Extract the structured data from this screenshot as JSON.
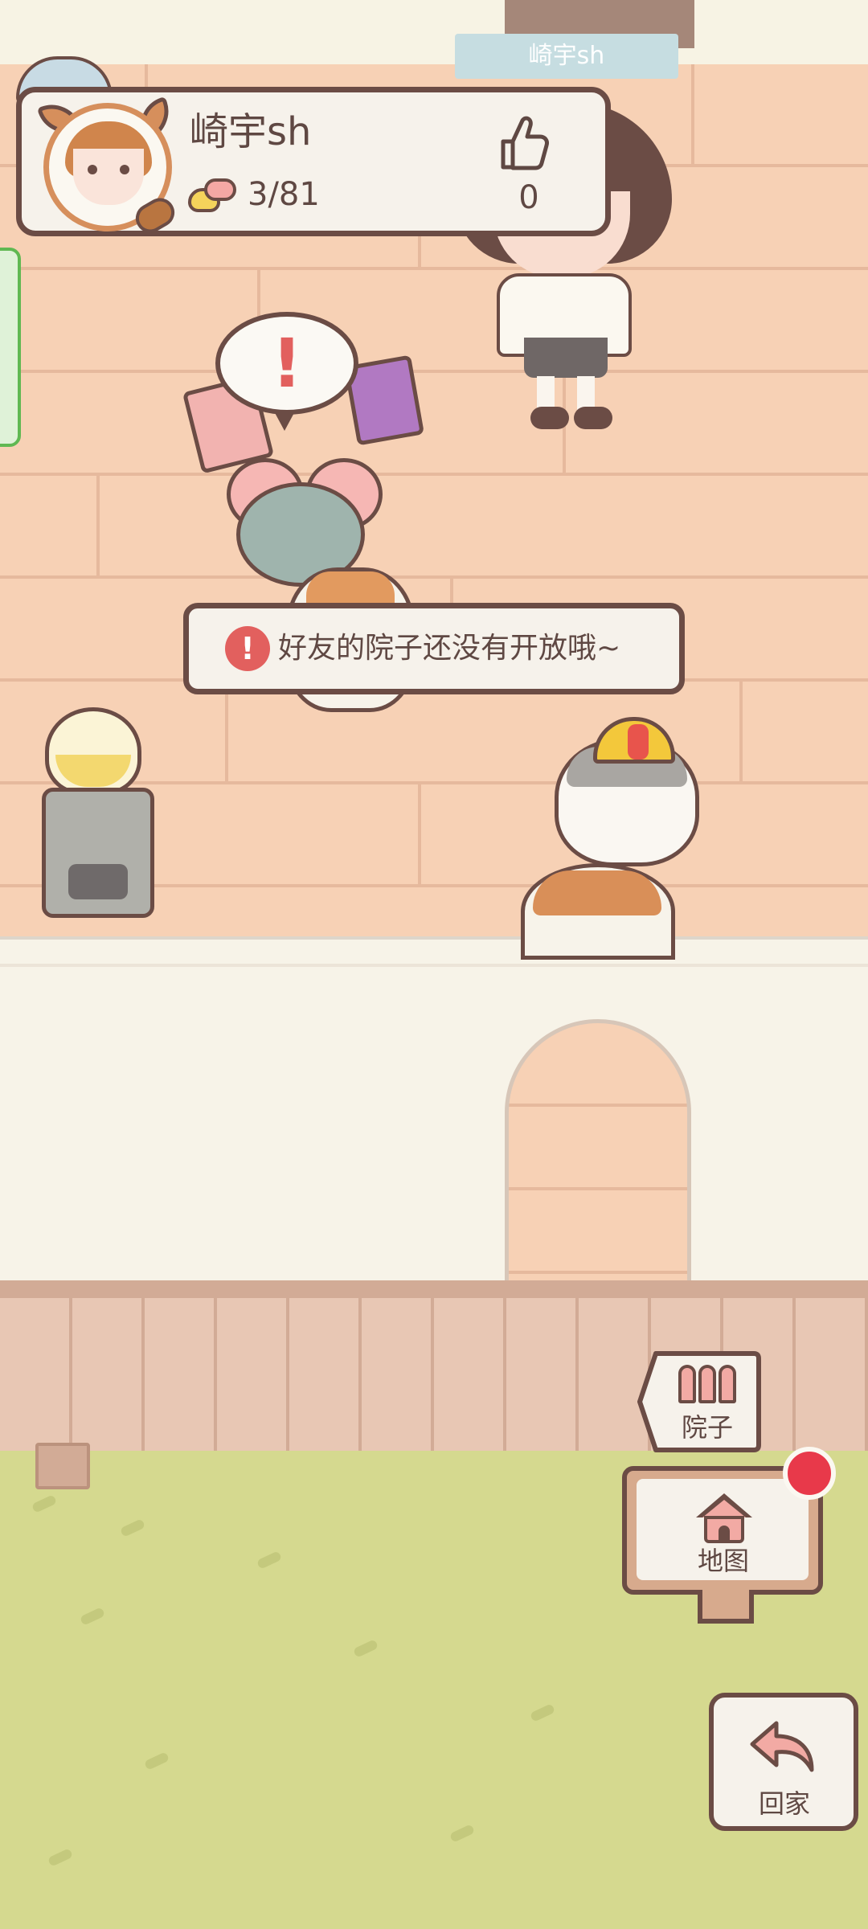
{
  "header": {
    "name_tab": "崎宇sh"
  },
  "profile": {
    "player_name": "崎宇sh",
    "coin_text": "3/81",
    "like_count": "0",
    "avatar_icon": "player-avatar",
    "coin_icon": "fish-coin-icon",
    "like_icon": "thumbs-up-icon"
  },
  "scene": {
    "speech_bubble_mark": "!"
  },
  "toast": {
    "icon_text": "!",
    "message": "好友的院子还没有开放哦~"
  },
  "nav": {
    "yard_label": "院子",
    "map_label": "地图",
    "home_label": "回家",
    "map_has_notification": true
  },
  "colors": {
    "outline": "#6b4c45",
    "floor": "#f7d1b5",
    "grass": "#d5d98f",
    "alert_red": "#e2605e",
    "notify_red": "#e8394a"
  }
}
